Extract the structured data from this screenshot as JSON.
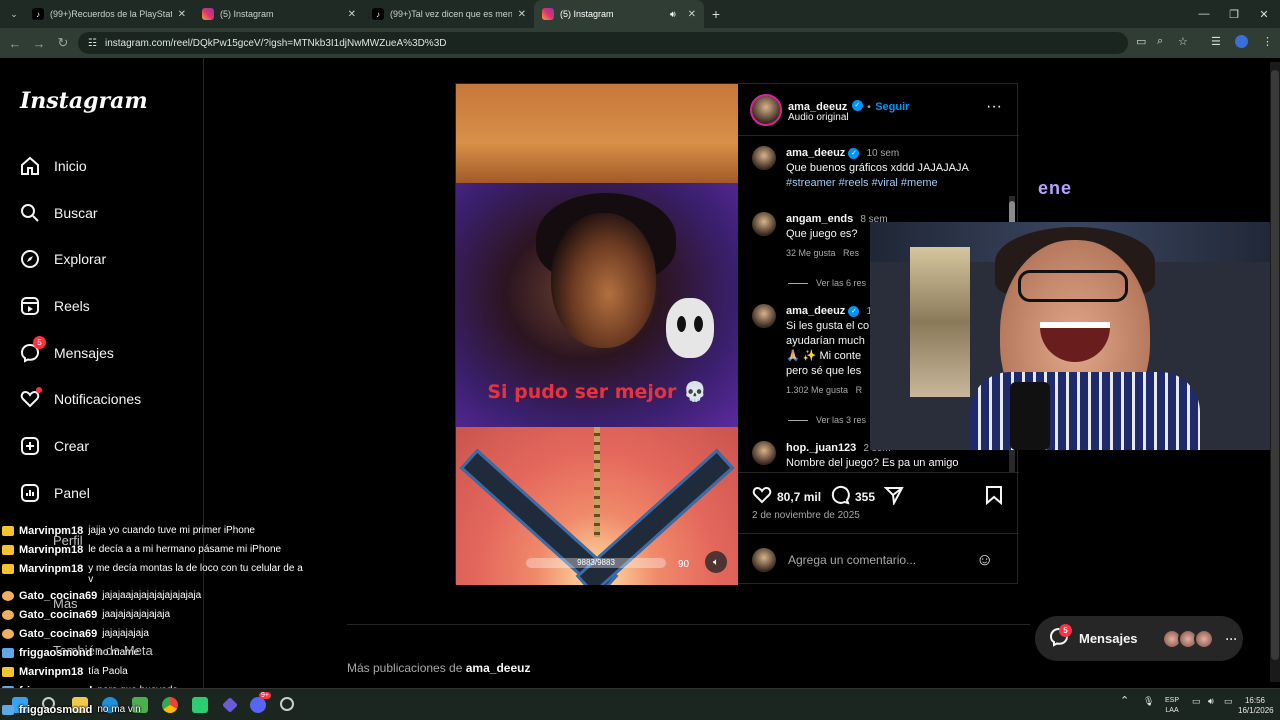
{
  "browser": {
    "tabs": [
      {
        "title": "(99+)Recuerdos de la PlayStation 2",
        "favicon": "tiktok-icon",
        "active": false
      },
      {
        "title": "(5) Instagram",
        "favicon": "instagram-icon",
        "active": false
      },
      {
        "title": "(99+)Tal vez dicen que es mentira",
        "favicon": "tiktok-icon",
        "active": false
      },
      {
        "title": "(5) Instagram",
        "favicon": "instagram-icon",
        "active": true
      }
    ],
    "new_tab": "+",
    "url": "instagram.com/reel/DQkPw15gceV/?igsh=MTNkb3I1djNwMWZueA%3D%3D"
  },
  "sidebar": {
    "logo": "Instagram",
    "items": [
      {
        "label": "Inicio",
        "icon": "home-icon"
      },
      {
        "label": "Buscar",
        "icon": "search-icon"
      },
      {
        "label": "Explorar",
        "icon": "compass-icon"
      },
      {
        "label": "Reels",
        "icon": "reels-icon"
      },
      {
        "label": "Mensajes",
        "icon": "messenger-icon",
        "badge": "5"
      },
      {
        "label": "Notificaciones",
        "icon": "heart-icon"
      },
      {
        "label": "Crear",
        "icon": "plus-square-icon"
      },
      {
        "label": "Panel",
        "icon": "chart-icon"
      }
    ],
    "profile_label": "Perfil",
    "more_label": "Más",
    "meta_label": "También de Meta"
  },
  "reel": {
    "caption_overlay": "Si pudo ser mejor 💀",
    "hud_text": "9883/9883",
    "hud_number": "90"
  },
  "post": {
    "author": "ama_deeuz",
    "follow": "Seguir",
    "audio": "Audio original",
    "caption": {
      "user": "ama_deeuz",
      "time": "10 sem",
      "text": "Que buenos gráficos xddd JAJAJAJA",
      "tags": "#streamer #reels #viral #meme"
    },
    "comments": [
      {
        "user": "angam_ends",
        "time": "8 sem",
        "text": "Que juego es?",
        "likes": "32 Me gusta",
        "reply": "Res",
        "view_replies": "Ver las 6 res"
      },
      {
        "user": "ama_deeuz",
        "time": "1",
        "lines": [
          "Si les gusta el co",
          "ayudarían much",
          "🙏🏼 ✨ Mi conte",
          "pero sé que les"
        ],
        "likes": "1.302 Me gusta",
        "reply": "R",
        "view_replies": "Ver las 3 res"
      },
      {
        "user": "hop._juan123",
        "time": "2 sem",
        "text": "Nombre del juego? Es pa un amigo"
      }
    ],
    "likes": "80,7 mil",
    "comment_count": "355",
    "date": "2 de noviembre de 2025",
    "add_comment_placeholder": "Agrega un comentario..."
  },
  "more_pubs": {
    "prefix": "Más publicaciones de",
    "user": "ama_deeuz"
  },
  "messages_pill": {
    "label": "Mensajes",
    "badge": "5"
  },
  "overlay_text": "ene",
  "chat": [
    {
      "user": "Marvinpm18",
      "msg": "jajja yo cuando tuve mi primer iPhone"
    },
    {
      "user": "Marvinpm18",
      "msg": "le decía a a mi hermano pásame mi iPhone"
    },
    {
      "user": "Marvinpm18",
      "msg": "y me decía montas la de loco con tu celular de a v"
    },
    {
      "user": "Gato_cocina69",
      "msg": "jajajaajajajajajajajajaja"
    },
    {
      "user": "Gato_cocina69",
      "msg": "jaajajajajajajaja"
    },
    {
      "user": "Gato_cocina69",
      "msg": "jajajajajaja"
    },
    {
      "user": "friggaosmond",
      "msg": "no mame"
    },
    {
      "user": "Marvinpm18",
      "msg": "tía Paola"
    },
    {
      "user": "friggaosmond",
      "msg": "pero que huevada"
    },
    {
      "user": "friggaosmond",
      "msg": "no ma vin"
    }
  ],
  "taskbar": {
    "lang_top": "ESP",
    "lang_bottom": "LAA",
    "time": "16:56",
    "date": "16/1/2026",
    "discord_badge": "9+"
  },
  "colors": {
    "accent": "#0095f6",
    "badge": "#ff3040",
    "caption": "#e8323c"
  }
}
